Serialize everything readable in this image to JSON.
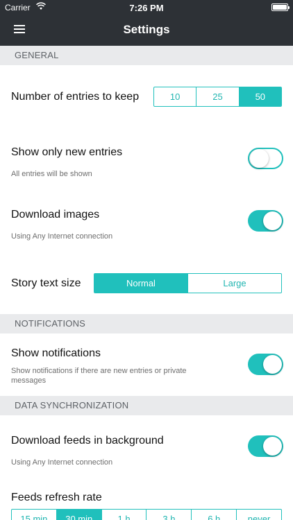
{
  "status_bar": {
    "carrier": "Carrier",
    "time": "7:26 PM"
  },
  "header": {
    "title": "Settings",
    "menu_icon": "hamburger-menu-icon"
  },
  "sections": {
    "general": "GENERAL",
    "notifications": "NOTIFICATIONS",
    "data_sync": "DATA SYNCHRONIZATION"
  },
  "entries_to_keep": {
    "label": "Number of entries to keep",
    "options": [
      "10",
      "25",
      "50"
    ],
    "selected": "50"
  },
  "show_new_entries": {
    "label": "Show only new entries",
    "sublabel": "All entries will be shown",
    "enabled": false
  },
  "download_images": {
    "label": "Download images",
    "sublabel": "Using Any Internet connection",
    "enabled": true
  },
  "story_text_size": {
    "label": "Story text size",
    "options": [
      "Normal",
      "Large"
    ],
    "selected": "Normal"
  },
  "show_notifications": {
    "label": "Show notifications",
    "sublabel": "Show notifications if there are new entries or private messages",
    "enabled": true
  },
  "download_feeds": {
    "label": "Download feeds in background",
    "sublabel": "Using Any Internet connection",
    "enabled": true
  },
  "refresh_rate": {
    "label": "Feeds refresh rate",
    "options": [
      "15 min",
      "30 min",
      "1 h",
      "3 h",
      "6 h",
      "never"
    ],
    "selected": "30 min"
  },
  "colors": {
    "accent": "#20c0bc",
    "header_bg": "#2d3136",
    "section_bg": "#e9eaec"
  }
}
